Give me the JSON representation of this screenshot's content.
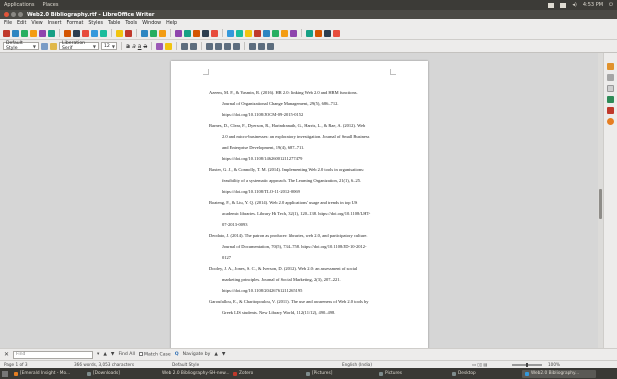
{
  "topbar": {
    "menus": [
      "Applications",
      "Places"
    ],
    "clock": "4:53 PM"
  },
  "window": {
    "title": "Web2.0 Bibliography.rtf - LibreOffice Writer"
  },
  "menubar": {
    "items": [
      "File",
      "Edit",
      "View",
      "Insert",
      "Format",
      "Styles",
      "Table",
      "Tools",
      "Window",
      "Help"
    ]
  },
  "format": {
    "paragraph_style": "Default Style",
    "font_name": "Liberation Serif",
    "font_size": "12"
  },
  "bibliography": [
    {
      "lines": [
        "Azeem, M. F., & Yasmin, R. (2016). HR 2.0: linking Web 2.0 and HRM functions.",
        "Journal of Organizational Change Management, 29(5), 686–712.",
        "https://doi.org/10.1108/JOCM-09-2015-0152"
      ]
    },
    {
      "lines": [
        "Barnes, D., Clear, F., Dyerson, R., Harindranath, G., Harris, L., & Rae, A. (2012). Web",
        "2.0 and micro-businesses: an exploratory investigation. Journal of Small Business",
        "and Enterprise Development, 19(4), 687–711.",
        "https://doi.org/10.1108/14626001211277479"
      ]
    },
    {
      "lines": [
        "Baxter, G. J., & Connolly, T. M. (2014). Implementing Web 2.0 tools in organisations:",
        "feasibility of a systematic approach. The Learning Organization, 21(1), 6–25.",
        "https://doi.org/10.1108/TLO-11-2012-0069"
      ]
    },
    {
      "lines": [
        "Boateng, F., & Liu, Y. Q. (2014). Web 2.0 applications' usage and trends in top US",
        "academic libraries. Library Hi Tech, 32(1), 120–138. https://doi.org/10.1108/LHT-",
        "07-2013-0093"
      ]
    },
    {
      "lines": [
        "Deodato, J. (2014). The patron as producer: libraries, web 2.0, and participatory culture.",
        "Journal of Documentation, 70(5), 734–758. https://doi.org/10.1108/JD-10-2012-",
        "0127"
      ]
    },
    {
      "lines": [
        "Dooley, J. A., Jones, S. C., & Iverson, D. (2012). Web 2.0: an assessment of social",
        "marketing principles. Journal of Social Marketing, 2(3), 207–221.",
        "https://doi.org/10.1108/20426761211265195"
      ]
    },
    {
      "lines": [
        "Garoufallou, E., & Charitopoulou, V. (2011). The use and awareness of Web 2.0 tools by",
        "Greek LIS students. New Library World, 112(11/12), 490–498."
      ]
    }
  ],
  "findbar": {
    "placeholder": "Find",
    "find_all": "Find All",
    "match_case": "Match Case",
    "navigate_by": "Navigate by"
  },
  "status": {
    "page": "Page 1 of 3",
    "words": "366 words, 3,053 characters",
    "style": "Default Style",
    "language": "English (India)",
    "zoom": "100%"
  },
  "taskbar": {
    "items": [
      {
        "label": "[Emerald Insight - Mo...",
        "active": false
      },
      {
        "label": "[Downloads]",
        "active": false
      },
      {
        "label": "Web 2.0 Bibliography-SH-new...",
        "active": false
      },
      {
        "label": "Zotero",
        "active": false
      },
      {
        "label": "[Pictures]",
        "active": false
      },
      {
        "label": "Pictures",
        "active": false
      },
      {
        "label": "Desktop",
        "active": false
      },
      {
        "label": "Web2.0 Bibliography...",
        "active": true
      }
    ]
  },
  "colors": {
    "toolbar_icons": [
      "#c0392b",
      "#2e86c1",
      "#27ae60",
      "#f39c12",
      "#8e44ad",
      "#16a085",
      "#d35400",
      "#2c3e50",
      "#e74c3c",
      "#3498db",
      "#1abc9c",
      "#f1c40f"
    ]
  }
}
